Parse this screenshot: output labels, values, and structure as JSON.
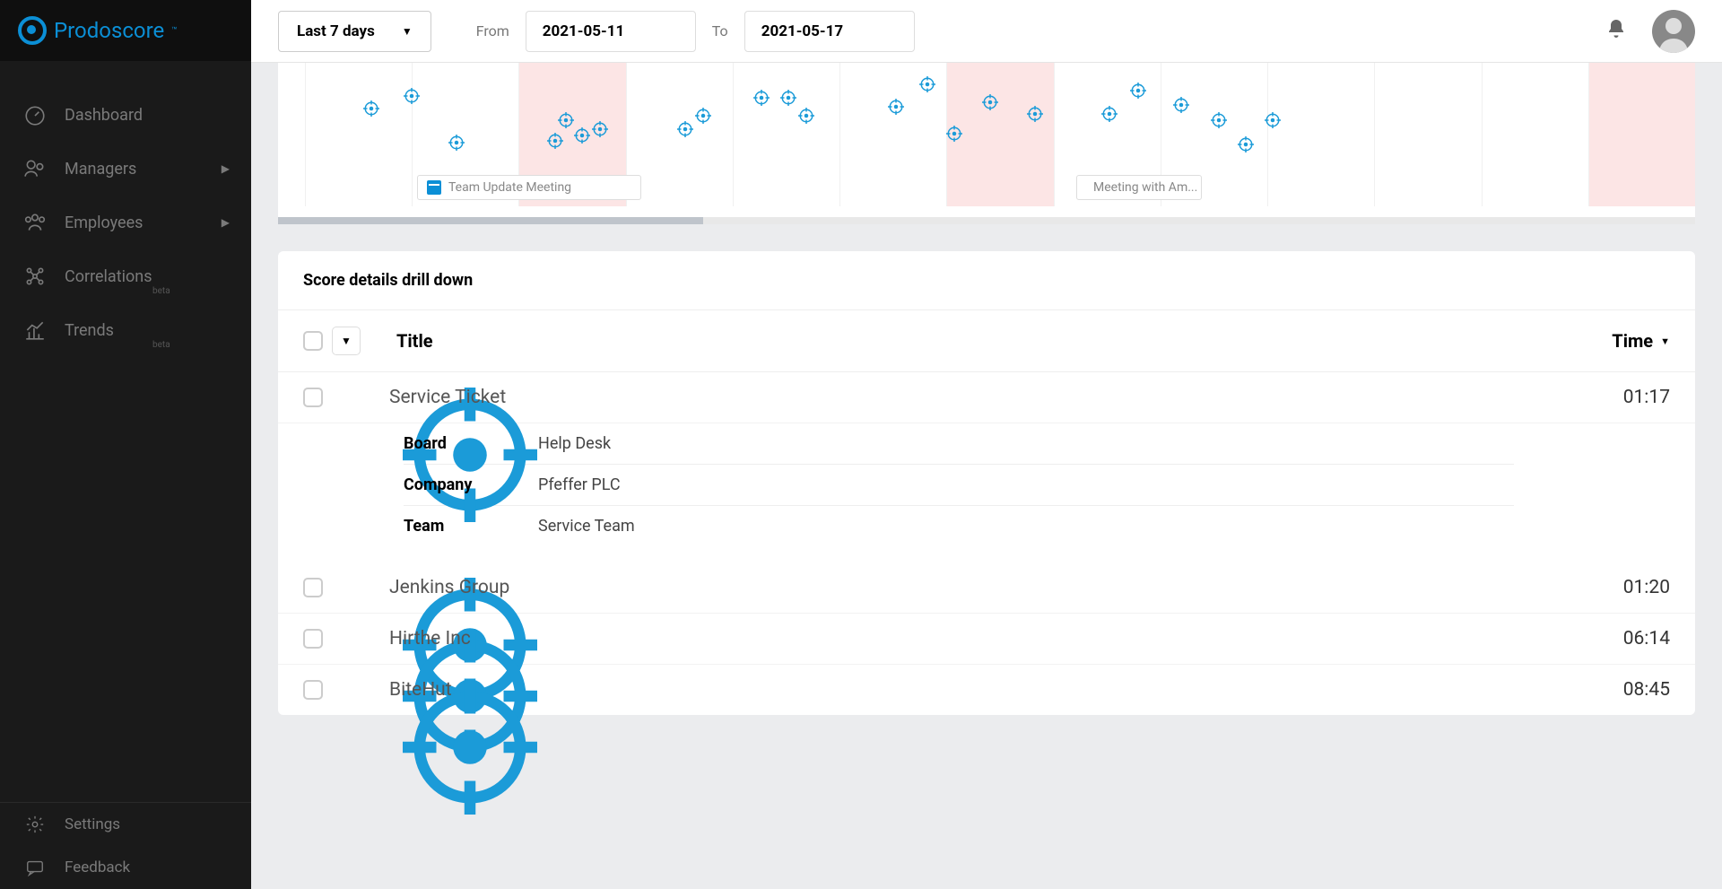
{
  "brand": "Prodoscore",
  "sidebar": {
    "items": [
      {
        "label": "Dashboard",
        "chevron": false,
        "beta": false
      },
      {
        "label": "Managers",
        "chevron": true,
        "beta": false
      },
      {
        "label": "Employees",
        "chevron": true,
        "beta": false
      },
      {
        "label": "Correlations",
        "chevron": false,
        "beta": true
      },
      {
        "label": "Trends",
        "chevron": false,
        "beta": true
      }
    ],
    "bottom": [
      {
        "label": "Settings"
      },
      {
        "label": "Feedback"
      }
    ],
    "beta_tag": "beta"
  },
  "header": {
    "range_label": "Last 7 days",
    "from_label": "From",
    "to_label": "To",
    "from_date": "2021-05-11",
    "to_date": "2021-05-17"
  },
  "timeline": {
    "events": [
      {
        "label": "Team Update Meeting"
      },
      {
        "label": "Meeting with Am..."
      }
    ]
  },
  "drilldown": {
    "title": "Score details drill down",
    "col_title": "Title",
    "col_time": "Time",
    "rows": [
      {
        "title": "Service Ticket",
        "time": "01:17",
        "expanded": true,
        "details": [
          {
            "label": "Board",
            "value": "Help Desk"
          },
          {
            "label": "Company",
            "value": "Pfeffer PLC"
          },
          {
            "label": "Team",
            "value": "Service Team"
          }
        ]
      },
      {
        "title": "Jenkins Group",
        "time": "01:20",
        "expanded": false
      },
      {
        "title": "Hirthe Inc",
        "time": "06:14",
        "expanded": false
      },
      {
        "title": "BiteHut",
        "time": "08:45",
        "expanded": false
      }
    ]
  }
}
